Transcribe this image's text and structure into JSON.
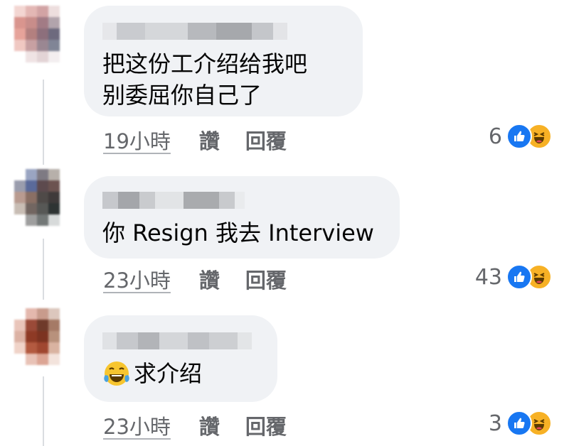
{
  "comments": [
    {
      "text": "把这份工介绍给我吧\n别委屈你自己了",
      "time": "19小時",
      "like": "讚",
      "reply": "回覆",
      "reaction_count": "6"
    },
    {
      "text": "你 Resign 我去 Interview",
      "time": "23小時",
      "like": "讚",
      "reply": "回覆",
      "reaction_count": "43"
    },
    {
      "text": "求介绍",
      "time": "23小時",
      "like": "讚",
      "reply": "回覆",
      "reaction_count": "3"
    }
  ],
  "icons": {
    "reaction_like": "thumbs-up-icon",
    "reaction_haha": "laughing-emoji-icon",
    "inline_emoji": "tears-of-joy-emoji-icon"
  },
  "colors": {
    "bubble_bg": "#f0f2f5",
    "meta_text": "#65676b",
    "like_blue": "#1877f2",
    "haha_yellow": "#f7b125"
  }
}
